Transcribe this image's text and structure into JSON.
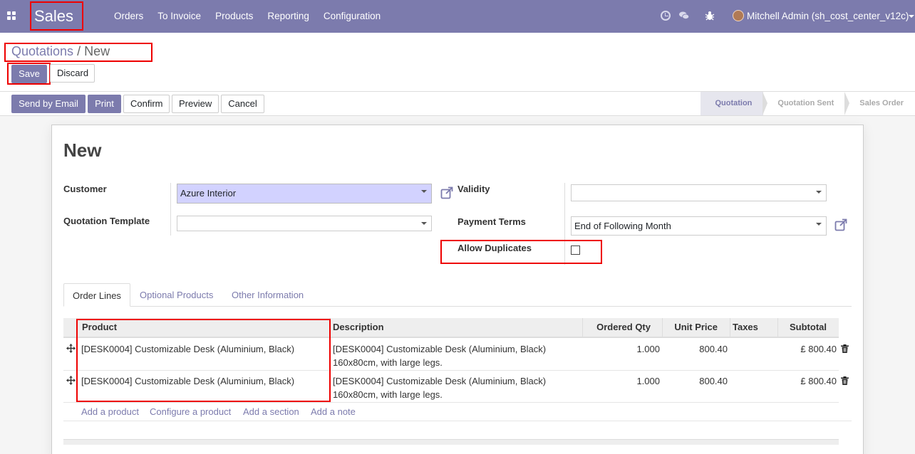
{
  "app": {
    "brand": "Sales"
  },
  "nav": {
    "menu": [
      "Orders",
      "To Invoice",
      "Products",
      "Reporting",
      "Configuration"
    ],
    "user": "Mitchell Admin (sh_cost_center_v12c)"
  },
  "breadcrumb": {
    "parent": "Quotations",
    "separator": "/",
    "current": "New"
  },
  "actions": {
    "save": "Save",
    "discard": "Discard"
  },
  "toolbar": {
    "send_email": "Send by Email",
    "print": "Print",
    "confirm": "Confirm",
    "preview": "Preview",
    "cancel": "Cancel"
  },
  "stages": [
    "Quotation",
    "Quotation Sent",
    "Sales Order"
  ],
  "form": {
    "title": "New",
    "customer_label": "Customer",
    "customer_value": "Azure Interior",
    "template_label": "Quotation Template",
    "template_value": "",
    "validity_label": "Validity",
    "validity_value": "",
    "payment_terms_label": "Payment Terms",
    "payment_terms_value": "End of Following Month",
    "allow_duplicates_label": "Allow Duplicates",
    "allow_duplicates_checked": false
  },
  "tabs": [
    "Order Lines",
    "Optional Products",
    "Other Information"
  ],
  "table": {
    "headers": [
      "Product",
      "Description",
      "Ordered Qty",
      "Unit Price",
      "Taxes",
      "Subtotal"
    ],
    "rows": [
      {
        "product": "[DESK0004] Customizable Desk (Aluminium, Black)",
        "description_1": "[DESK0004] Customizable Desk (Aluminium, Black)",
        "description_2": "160x80cm, with large legs.",
        "qty": "1.000",
        "price": "800.40",
        "taxes": "",
        "subtotal": "£ 800.40"
      },
      {
        "product": "[DESK0004] Customizable Desk (Aluminium, Black)",
        "description_1": "[DESK0004] Customizable Desk (Aluminium, Black)",
        "description_2": "160x80cm, with large legs.",
        "qty": "1.000",
        "price": "800.40",
        "taxes": "",
        "subtotal": "£ 800.40"
      }
    ],
    "add_links": [
      "Add a product",
      "Configure a product",
      "Add a section",
      "Add a note"
    ]
  },
  "colors": {
    "brand": "#7C7BAD",
    "highlight": "#EE0000",
    "required_field": "#D2D2FF"
  }
}
